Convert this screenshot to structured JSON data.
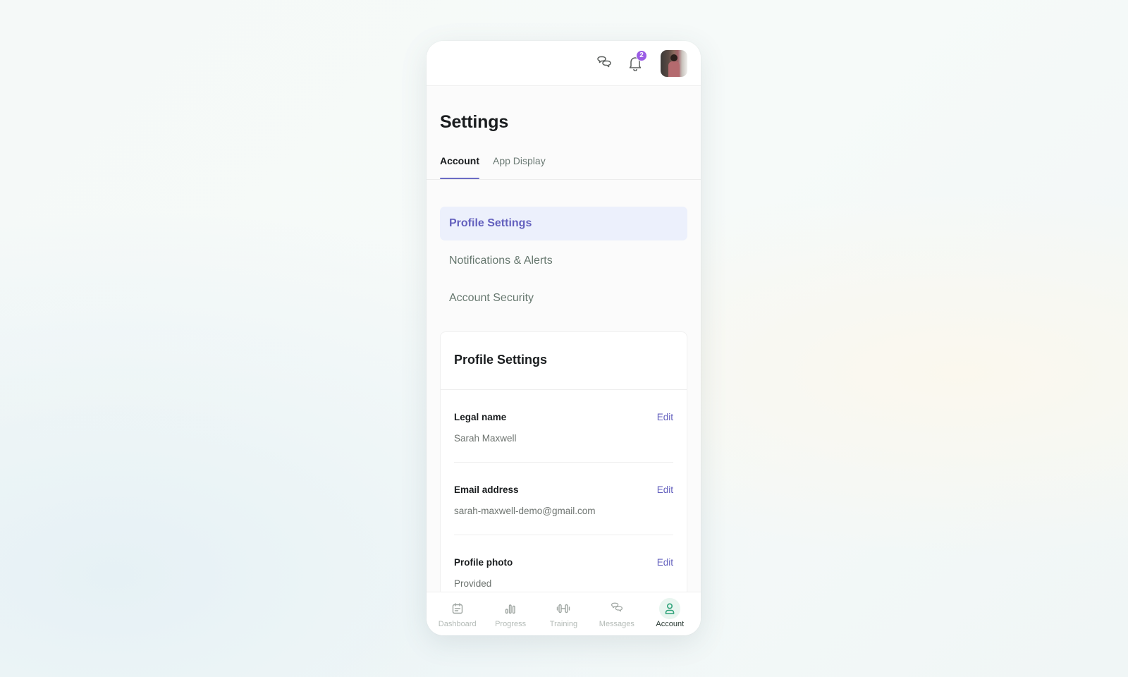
{
  "topbar": {
    "messages_icon": "chat-bubbles-icon",
    "notifications_icon": "bell-icon",
    "notification_count": "2",
    "avatar_alt": "User profile photo"
  },
  "header": {
    "title": "Settings",
    "tabs": [
      {
        "label": "Account",
        "active": true
      },
      {
        "label": "App Display",
        "active": false
      }
    ]
  },
  "menu": {
    "items": [
      {
        "label": "Profile Settings",
        "active": true
      },
      {
        "label": "Notifications & Alerts",
        "active": false
      },
      {
        "label": "Account Security",
        "active": false
      }
    ]
  },
  "profile_card": {
    "title": "Profile Settings",
    "fields": [
      {
        "label": "Legal name",
        "value": "Sarah Maxwell",
        "action": "Edit"
      },
      {
        "label": "Email address",
        "value": "sarah-maxwell-demo@gmail.com",
        "action": "Edit"
      },
      {
        "label": "Profile photo",
        "value": "Provided",
        "action": "Edit"
      }
    ]
  },
  "bottom_nav": {
    "items": [
      {
        "label": "Dashboard",
        "icon": "calendar-icon",
        "active": false
      },
      {
        "label": "Progress",
        "icon": "bar-chart-icon",
        "active": false
      },
      {
        "label": "Training",
        "icon": "dumbbell-icon",
        "active": false
      },
      {
        "label": "Messages",
        "icon": "chat-bubbles-icon",
        "active": false
      },
      {
        "label": "Account",
        "icon": "user-icon",
        "active": true
      }
    ]
  },
  "colors": {
    "accent": "#6461be",
    "active_menu_bg": "#ecf0fc",
    "badge": "#9b5de5",
    "nav_active_bg": "#e8f5ef",
    "nav_active_icon": "#2fa37a"
  }
}
